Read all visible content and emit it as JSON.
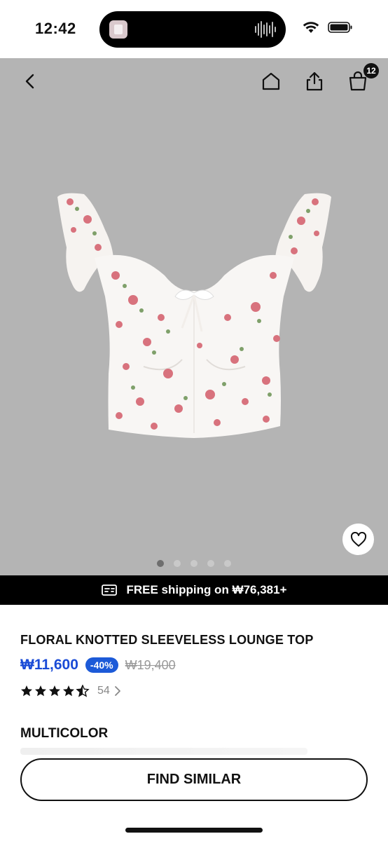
{
  "status_bar": {
    "time": "12:42"
  },
  "nav": {
    "cart_count": "12"
  },
  "gallery": {
    "image_count": 5,
    "active_index": 0
  },
  "shipping": {
    "text": "FREE shipping on ₩76,381+"
  },
  "product": {
    "title": "FLORAL KNOTTED SLEEVELESS LOUNGE TOP",
    "price": "₩11,600",
    "discount": "-40%",
    "original_price": "₩19,400",
    "rating": 4.5,
    "review_count": "54",
    "color": "MULTICOLOR"
  },
  "actions": {
    "find_similar_label": "FIND SIMILAR"
  },
  "colors": {
    "accent_blue": "#1a4bd6",
    "badge_blue": "#1c5ad8",
    "image_bg": "#b4b4b4"
  }
}
